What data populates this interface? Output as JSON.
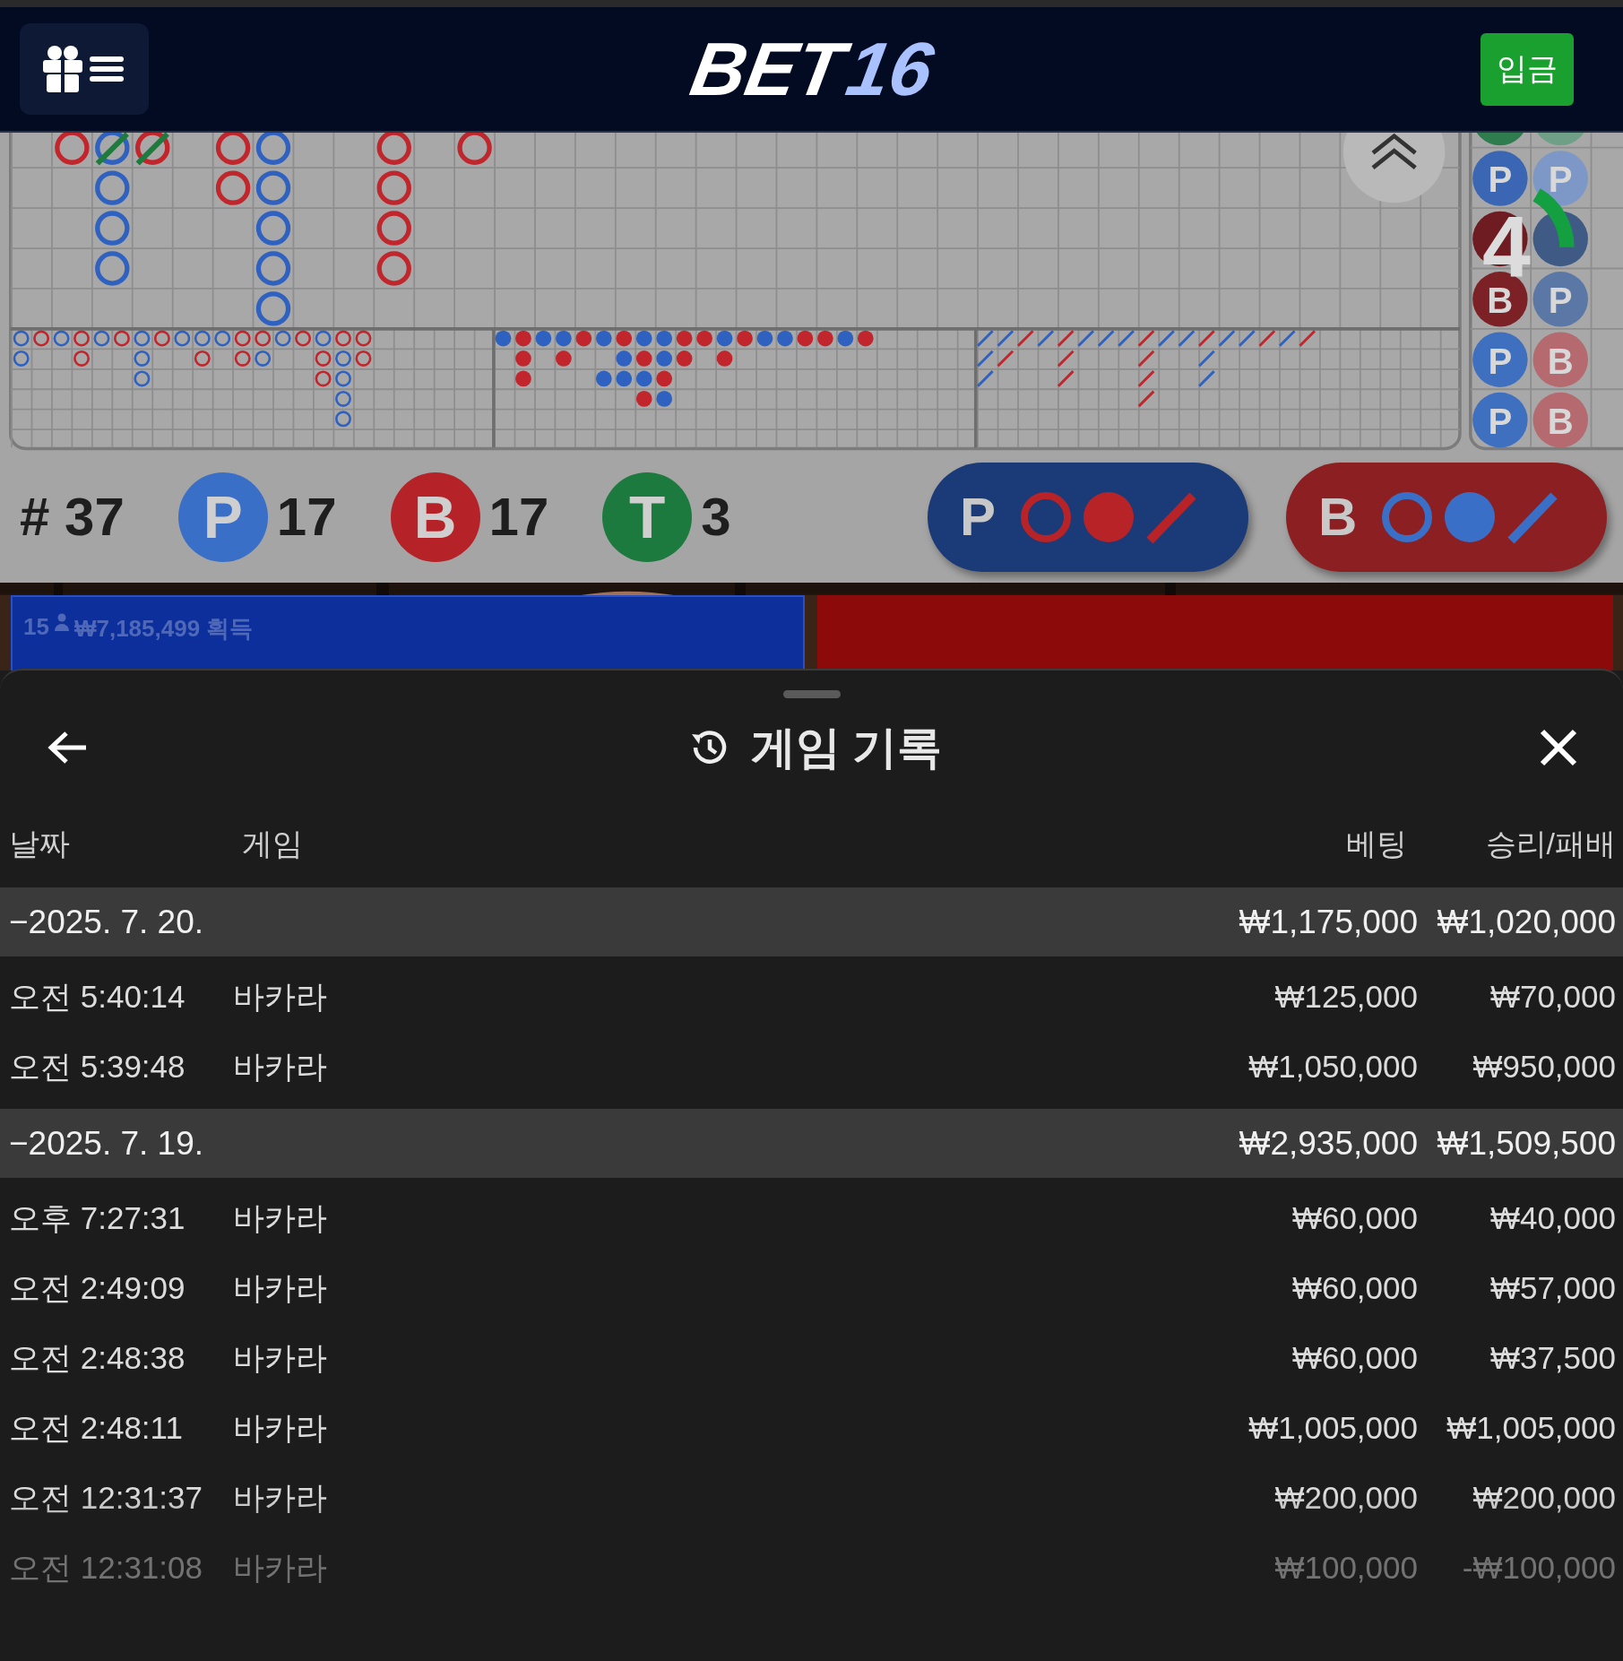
{
  "header": {
    "logo": {
      "part_1": "BET",
      "part_2": "16"
    },
    "deposit_button": "입금"
  },
  "roadmap": {
    "countdown": "4",
    "bead_plate": [
      [
        {
          "color": "#2f7d4f"
        },
        {
          "label": "P",
          "color": "#3a66b4"
        },
        {
          "color": "#6e1c22"
        },
        {
          "label": "B",
          "color": "#7c2226"
        },
        {
          "label": "P",
          "color": "#3f6fbf"
        },
        {
          "label": "P",
          "color": "#3f6fbf"
        }
      ],
      [
        {
          "color": "#6f9f86"
        },
        {
          "label": "P",
          "color": "#7d98c6"
        },
        {
          "color": "#3f5a85"
        },
        {
          "label": "P",
          "color": "#5a77a6"
        },
        {
          "label": "B",
          "color": "#b46a6e"
        },
        {
          "label": "B",
          "color": "#b46a6e"
        }
      ]
    ]
  },
  "stats": {
    "round": "# 37",
    "counts": [
      {
        "label": "P",
        "value": "17",
        "color": "#3a6fc8"
      },
      {
        "label": "B",
        "value": "17",
        "color": "#b52328"
      },
      {
        "label": "T",
        "value": "3",
        "color": "#1d7a3f"
      }
    ]
  },
  "predict_buttons": [
    {
      "label": "P",
      "color": "#1b3a78",
      "marks": {
        "color": "#b82328"
      }
    },
    {
      "label": "B",
      "color": "#8c1f22",
      "marks": {
        "color": "#3a6fc8"
      }
    }
  ],
  "video": {
    "kind": "picture",
    "player_panel": {
      "count": "15",
      "amount": "₩7,185,499 획득"
    }
  },
  "sheet": {
    "title": "게임 기록",
    "columns": [
      "날짜",
      "게임",
      "베팅",
      "승리/패배"
    ],
    "groups": [
      {
        "date": "−2025. 7. 20.",
        "bet": "₩1,175,000",
        "result": "₩1,020,000",
        "entries": [
          {
            "time": "오전 5:40:14",
            "game": "바카라",
            "bet": "₩125,000",
            "result": "₩70,000"
          },
          {
            "time": "오전 5:39:48",
            "game": "바카라",
            "bet": "₩1,050,000",
            "result": "₩950,000"
          }
        ]
      },
      {
        "date": "−2025. 7. 19.",
        "bet": "₩2,935,000",
        "result": "₩1,509,500",
        "entries": [
          {
            "time": "오후 7:27:31",
            "game": "바카라",
            "bet": "₩60,000",
            "result": "₩40,000"
          },
          {
            "time": "오전 2:49:09",
            "game": "바카라",
            "bet": "₩60,000",
            "result": "₩57,000"
          },
          {
            "time": "오전 2:48:38",
            "game": "바카라",
            "bet": "₩60,000",
            "result": "₩37,500"
          },
          {
            "time": "오전 2:48:11",
            "game": "바카라",
            "bet": "₩1,005,000",
            "result": "₩1,005,000"
          },
          {
            "time": "오전 12:31:37",
            "game": "바카라",
            "bet": "₩200,000",
            "result": "₩200,000"
          },
          {
            "time": "오전 12:31:08",
            "game": "바카라",
            "bet": "₩100,000",
            "result": "-₩100,000"
          }
        ]
      }
    ]
  }
}
